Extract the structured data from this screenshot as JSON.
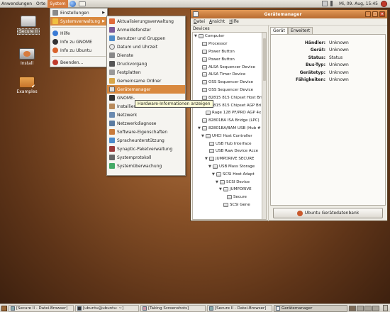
{
  "top_panel": {
    "menus": [
      "Anwendungen",
      "Orte",
      "System"
    ],
    "clock": "Mi, 09. Aug, 15:45"
  },
  "desktop": {
    "icons": [
      {
        "label": "Secure II"
      },
      {
        "label": "Install"
      },
      {
        "label": "Examples"
      }
    ]
  },
  "system_menu": {
    "items": [
      {
        "label": "Einstellungen",
        "submenu": true
      },
      {
        "label": "Systemverwaltung",
        "submenu": true
      },
      {
        "label": "Hilfe"
      },
      {
        "label": "Info zu GNOME"
      },
      {
        "label": "Info zu Ubuntu"
      },
      {
        "label": "Beenden..."
      }
    ]
  },
  "admin_menu": {
    "items": [
      "Aktualisierungsverwaltung",
      "Anmeldefenster",
      "Benutzer und Gruppen",
      "Datum und Uhrzeit",
      "Dienste",
      "Druckvorgang",
      "Festplatten",
      "Gemeinsame Ordner",
      "Gerätemanager",
      "GNOME-Anmeldung",
      "Installieren",
      "Netzwerk",
      "Netzwerkdiagnose",
      "Software-Eigenschaften",
      "Spracheunterstützung",
      "Synaptic-Paketverwaltung",
      "Systemprotokoll",
      "Systemüberwachung"
    ],
    "gnome_short": "GNOME-"
  },
  "tooltip": "Hardware-Informationen anzeigen",
  "window": {
    "title": "Gerätemanager",
    "menubar": [
      {
        "u": "D",
        "rest": "atei"
      },
      {
        "u": "A",
        "rest": "nsicht"
      },
      {
        "u": "H",
        "rest": "ilfe"
      }
    ],
    "devices_header": "Devices",
    "tree": [
      {
        "label": "Computer",
        "indent": 0,
        "toggle": "▼"
      },
      {
        "label": "Processor",
        "indent": 1,
        "toggle": ""
      },
      {
        "label": "Power Button",
        "indent": 1,
        "toggle": ""
      },
      {
        "label": "Power Button",
        "indent": 1,
        "toggle": ""
      },
      {
        "label": "ALSA Sequencer Device",
        "indent": 1,
        "toggle": ""
      },
      {
        "label": "ALSA Timer Device",
        "indent": 1,
        "toggle": ""
      },
      {
        "label": "OSS Sequencer Device",
        "indent": 1,
        "toggle": ""
      },
      {
        "label": "OSS Sequencer Device",
        "indent": 1,
        "toggle": ""
      },
      {
        "label": "82815 815 Chipset Host Bri",
        "indent": 1,
        "toggle": ""
      },
      {
        "label": "82815 815 Chipset AGP Bri",
        "indent": 1,
        "toggle": "▼"
      },
      {
        "label": "Rage 128 PF/PRO AGP 4x",
        "indent": 2,
        "toggle": ""
      },
      {
        "label": "82801BA ISA Bridge (LPC)",
        "indent": 1,
        "toggle": ""
      },
      {
        "label": "82801BA/BAM USB (Hub #",
        "indent": 1,
        "toggle": "▼"
      },
      {
        "label": "UHCI Host Controller",
        "indent": 2,
        "toggle": "▼"
      },
      {
        "label": "USB Hub Interface",
        "indent": 3,
        "toggle": ""
      },
      {
        "label": "USB Raw Device Acce",
        "indent": 3,
        "toggle": ""
      },
      {
        "label": "JUMPDRIVE SECURE",
        "indent": 3,
        "toggle": "▼"
      },
      {
        "label": "USB Mass Storage",
        "indent": 4,
        "toggle": "▼"
      },
      {
        "label": "SCSI Host Adapt",
        "indent": 5,
        "toggle": "▼"
      },
      {
        "label": "SCSI Device",
        "indent": 6,
        "toggle": "▼"
      },
      {
        "label": "JUMPDRIVE",
        "indent": 7,
        "toggle": "▼"
      },
      {
        "label": "Secure",
        "indent": 8,
        "toggle": ""
      },
      {
        "label": "SCSI Gene",
        "indent": 7,
        "toggle": ""
      }
    ],
    "tabs": [
      "Gerät",
      "Erweitert"
    ],
    "properties": [
      {
        "key": "Händler:",
        "value": "Unknown"
      },
      {
        "key": "Gerät:",
        "value": "Unknown"
      },
      {
        "key": "Status:",
        "value": "Status"
      },
      {
        "key": "Bus-Typ:",
        "value": "Unknown"
      },
      {
        "key": "Gerätetyp:",
        "value": "Unknown"
      },
      {
        "key": "Fähigkeiten:",
        "value": "Unknown"
      }
    ],
    "db_button": "Ubuntu Gerätedatenbank"
  },
  "taskbar": {
    "tasks": [
      {
        "label": "[Secure II - Datei-Browser]",
        "active": false
      },
      {
        "label": "[ubuntu@ubuntu: ~]",
        "active": false
      },
      {
        "label": "[Taking Screenshots]",
        "active": false
      },
      {
        "label": "[Secure II - Datei-Browser]",
        "active": false
      },
      {
        "label": "Gerätemanager",
        "active": true
      }
    ]
  },
  "colors": {
    "accent": "#d9893f",
    "titlebar": "#c77a3b",
    "desktop": "#8a5228"
  },
  "icons": {
    "system_menu": [
      "gear-icon",
      "admin-icon",
      "help-icon",
      "gnome-icon",
      "ubuntu-icon",
      "exit-icon"
    ]
  }
}
